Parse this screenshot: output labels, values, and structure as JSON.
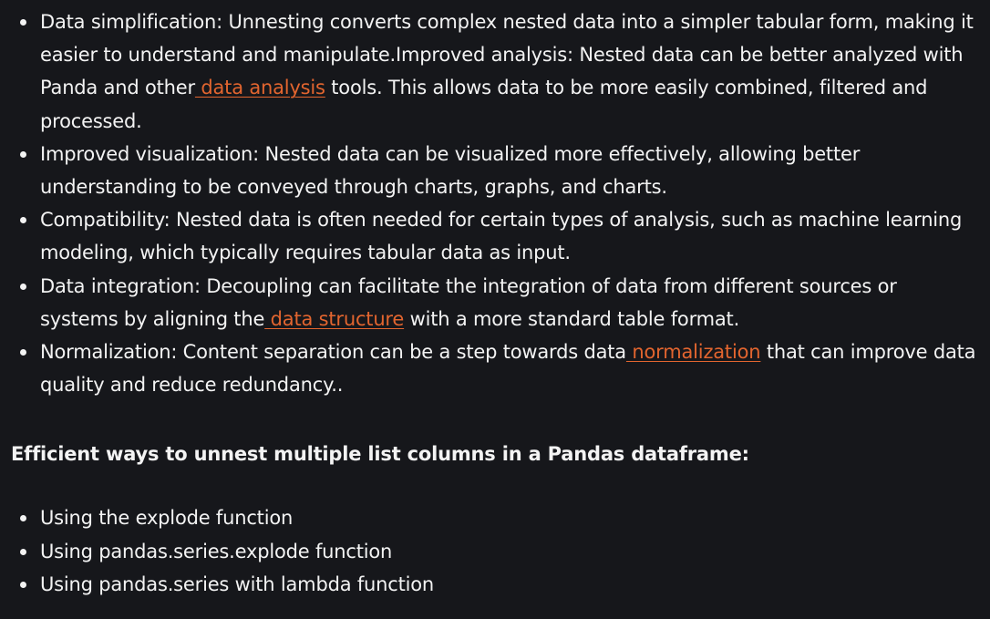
{
  "benefits": [
    {
      "before": "Data simplification: Unnesting converts complex nested data into a simpler tabular form, making it easier to understand and manipulate.Improved analysis: Nested data can be better analyzed with Panda and other",
      "link": " data analysis",
      "after": " tools. This allows data to be more easily combined, filtered and processed."
    },
    {
      "before": "Improved visualization: Nested data can be visualized more effectively, allowing better understanding to be conveyed through charts, graphs, and charts.",
      "link": "",
      "after": ""
    },
    {
      "before": "Compatibility: Nested data is often needed for certain types of analysis, such as machine learning modeling, which typically requires tabular data as input.",
      "link": "",
      "after": ""
    },
    {
      "before": "Data integration: Decoupling can facilitate the integration of data from different sources or systems by aligning the",
      "link": " data structure",
      "after": " with a more standard table format."
    },
    {
      "before": "Normalization: Content separation can be a step towards data",
      "link": " normalization",
      "after": " that can improve data quality and reduce redundancy.."
    }
  ],
  "heading": "Efficient ways to unnest multiple list columns in a Pandas dataframe:",
  "methods": [
    "Using the explode function",
    "Using pandas.series.explode function",
    "Using pandas.series with lambda function"
  ],
  "colors": {
    "background": "#16171b",
    "text": "#f3f3f3",
    "link": "#e2652f"
  }
}
